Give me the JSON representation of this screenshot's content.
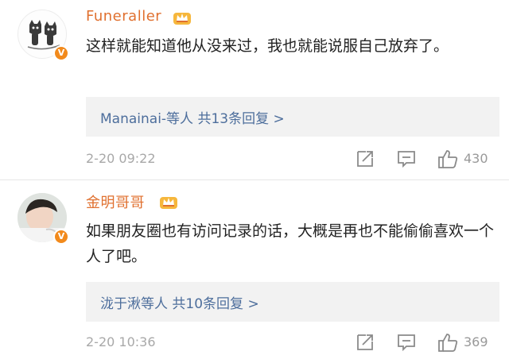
{
  "comments": [
    {
      "username": "Funeraller",
      "verified_badge": "V",
      "text": "这样就能知道他从没来过，我也就能说服自己放弃了。",
      "replies": "Manainai-等人  共13条回复 >",
      "time": "2-20 09:22",
      "likes": "430"
    },
    {
      "username": "金明哥哥",
      "verified_badge": "V",
      "text": "如果朋友圈也有访问记录的话，大概是再也不能偷偷喜欢一个人了吧。",
      "replies": "泷于湫等人  共10条回复 >",
      "time": "2-20 10:36",
      "likes": "369"
    }
  ],
  "icons": {
    "crown": "vip-crown-icon",
    "share": "share-icon",
    "comment": "comment-icon",
    "like": "thumbs-up-icon"
  },
  "colors": {
    "username": "#e0702f",
    "reply_link": "#4d6e9c",
    "badge": "#f28a1c",
    "reply_bg": "#f2f2f2",
    "meta": "#a8a8a8"
  }
}
